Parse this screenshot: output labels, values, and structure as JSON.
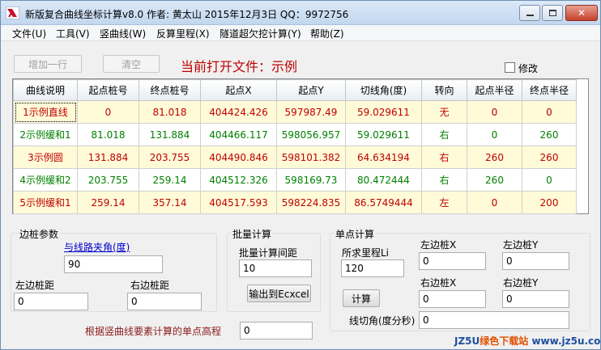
{
  "window": {
    "title": "新版复合曲线坐标计算v8.0  作者: 黄太山 2015年12月3日 QQ：9972756",
    "min_glyph": "—",
    "max_glyph": "□",
    "close_glyph": "✕"
  },
  "menu": [
    "文件(U)",
    "工具(V)",
    "竖曲线(W)",
    "反算里程(X)",
    "隧道超欠挖计算(Y)",
    "帮助(Z)"
  ],
  "toolbar": {
    "add_row_label": "增加一行",
    "clear_label": "清空",
    "current_file_label": "当前打开文件：示例",
    "modify_label": "修改"
  },
  "grid": {
    "headers": [
      "曲线说明",
      "起点桩号",
      "终点桩号",
      "起点X",
      "起点Y",
      "切线角(度)",
      "转向",
      "起点半径",
      "终点半径"
    ],
    "rows": [
      [
        "1示例直线",
        "0",
        "81.018",
        "404424.426",
        "597987.49",
        "59.029611",
        "无",
        "0",
        "0"
      ],
      [
        "2示例缓和1",
        "81.018",
        "131.884",
        "404466.117",
        "598056.957",
        "59.029611",
        "右",
        "0",
        "260"
      ],
      [
        "3示例圆",
        "131.884",
        "203.755",
        "404490.846",
        "598101.382",
        "64.634194",
        "右",
        "260",
        "260"
      ],
      [
        "4示例缓和2",
        "203.755",
        "259.14",
        "404512.326",
        "598169.73",
        "80.472444",
        "右",
        "260",
        "0"
      ],
      [
        "5示例缓和1",
        "259.14",
        "357.14",
        "404517.593",
        "598224.835",
        "86.5749444",
        "左",
        "0",
        "200"
      ]
    ]
  },
  "side_stake": {
    "group_title": "边桩参数",
    "angle_label": "与线路夹角(度)",
    "angle_value": "90",
    "left_dist_label": "左边桩距",
    "left_dist_value": "0",
    "right_dist_label": "右边桩距",
    "right_dist_value": "0"
  },
  "batch": {
    "group_title": "批量计算",
    "interval_label": "批量计算间距",
    "interval_value": "10",
    "export_label": "输出到Ecxcel"
  },
  "single": {
    "group_title": "单点计算",
    "chainage_label": "所求里程Li",
    "chainage_value": "120",
    "left_x_label": "左边桩X",
    "left_x_value": "0",
    "left_y_label": "左边桩Y",
    "left_y_value": "0",
    "right_x_label": "右边桩X",
    "right_x_value": "0",
    "right_y_label": "右边桩Y",
    "right_y_value": "0",
    "calc_label": "计算",
    "tangent_label": "线切角(度分秒)",
    "tangent_value": "0"
  },
  "elevation": {
    "label": "根据竖曲线要素计算的单点高程",
    "value": "0"
  },
  "watermark": {
    "prefix": "JZ5U",
    "highlight": "绿色下载站",
    "suffix": " www.jz5u.com"
  },
  "colors": {
    "odd_row_text": "#c00000",
    "even_row_text": "#008000",
    "odd_row_bg": "#fffbd8",
    "accent_red": "#c00000"
  }
}
